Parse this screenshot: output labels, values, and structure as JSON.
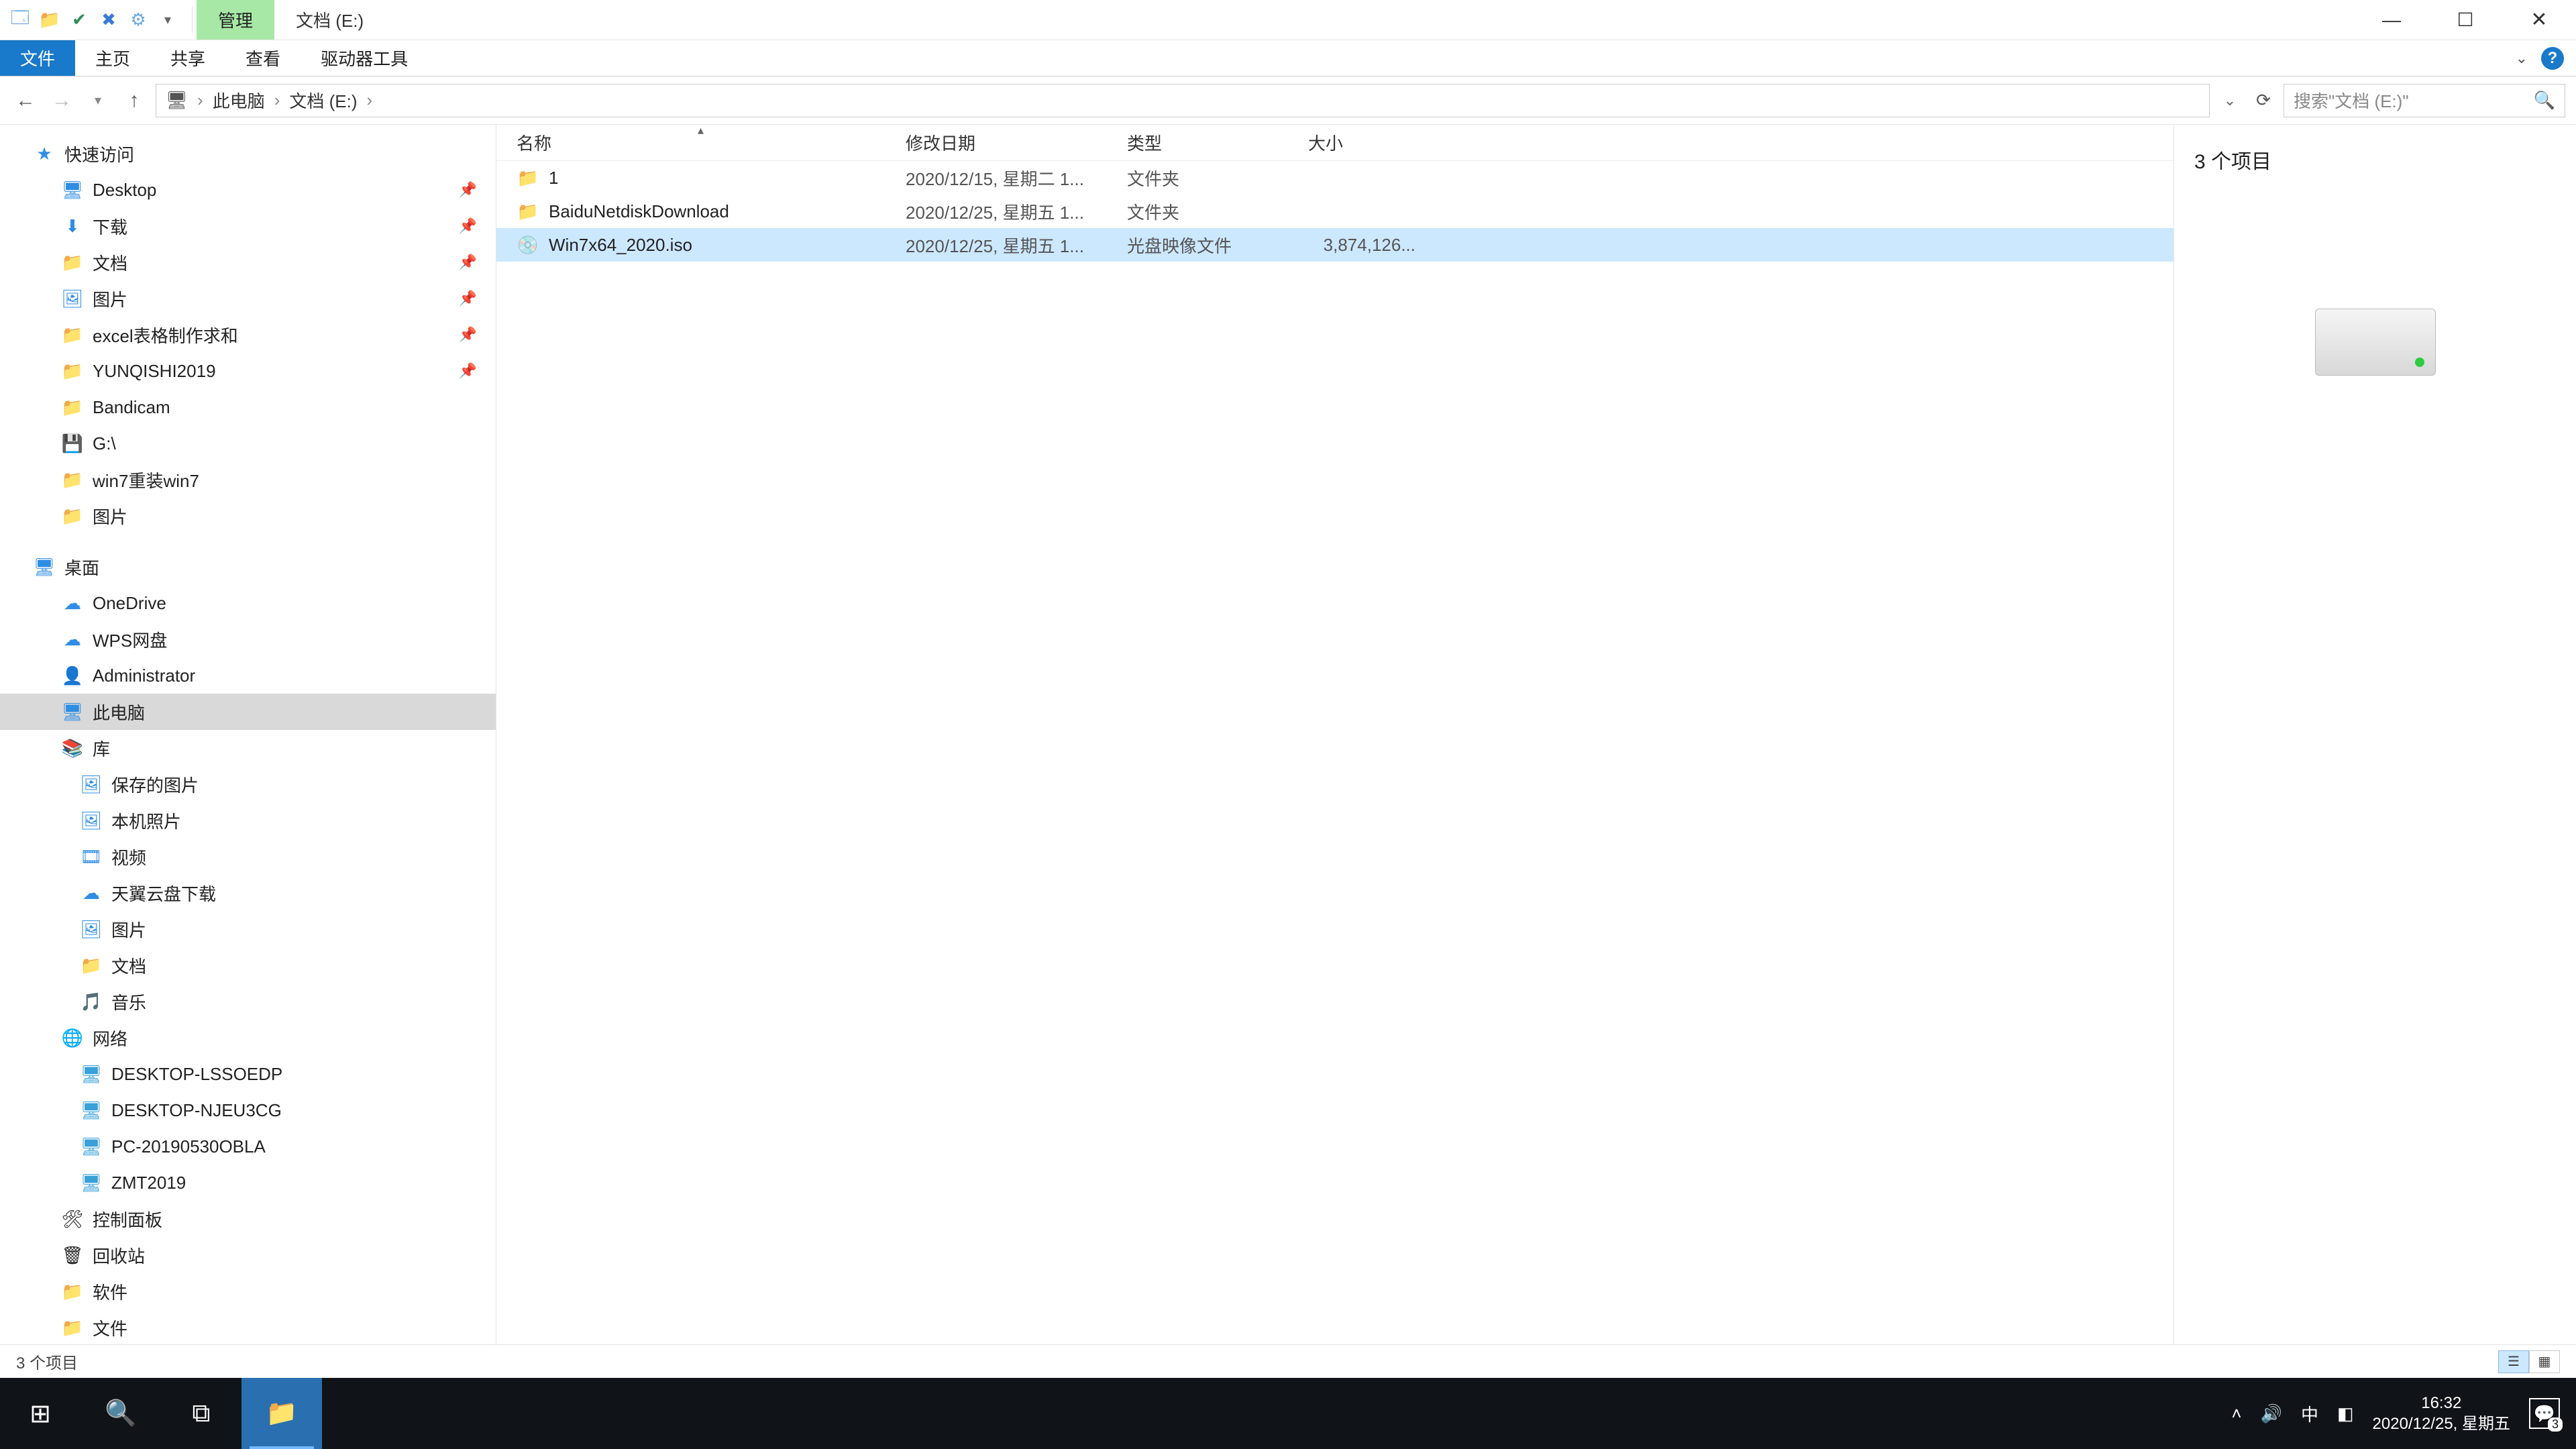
{
  "titlebar": {
    "contextual_tab": "管理",
    "window_title": "文档 (E:)"
  },
  "ribbon": {
    "file": "文件",
    "home": "主页",
    "share": "共享",
    "view": "查看",
    "drive_tools": "驱动器工具"
  },
  "address": {
    "root": "此电脑",
    "current": "文档 (E:)"
  },
  "search": {
    "placeholder": "搜索\"文档 (E:)\""
  },
  "tree": {
    "quick_access": "快速访问",
    "desktop": "Desktop",
    "downloads": "下载",
    "documents": "文档",
    "pictures": "图片",
    "excel_req": "excel表格制作求和",
    "yunqishi": "YUNQISHI2019",
    "bandicam": "Bandicam",
    "gdrive": "G:\\",
    "win7reinstall": "win7重装win7",
    "pictures2": "图片",
    "desktop_cn": "桌面",
    "onedrive": "OneDrive",
    "wps": "WPS网盘",
    "admin": "Administrator",
    "this_pc": "此电脑",
    "library": "库",
    "saved_pics": "保存的图片",
    "local_photos": "本机照片",
    "videos": "视频",
    "tianyi": "天翼云盘下载",
    "pictures3": "图片",
    "documents2": "文档",
    "music": "音乐",
    "network": "网络",
    "pc1": "DESKTOP-LSSOEDP",
    "pc2": "DESKTOP-NJEU3CG",
    "pc3": "PC-20190530OBLA",
    "pc4": "ZMT2019",
    "control_panel": "控制面板",
    "recycle": "回收站",
    "software": "软件",
    "files": "文件"
  },
  "columns": {
    "name": "名称",
    "date": "修改日期",
    "type": "类型",
    "size": "大小"
  },
  "rows": [
    {
      "name": "1",
      "date": "2020/12/15, 星期二 1...",
      "type": "文件夹",
      "size": "",
      "icon": "folder",
      "selected": false
    },
    {
      "name": "BaiduNetdiskDownload",
      "date": "2020/12/25, 星期五 1...",
      "type": "文件夹",
      "size": "",
      "icon": "folder",
      "selected": false
    },
    {
      "name": "Win7x64_2020.iso",
      "date": "2020/12/25, 星期五 1...",
      "type": "光盘映像文件",
      "size": "3,874,126...",
      "icon": "disc",
      "selected": true
    }
  ],
  "preview": {
    "title": "3 个项目"
  },
  "status": {
    "text": "3 个项目"
  },
  "taskbar": {
    "time": "16:32",
    "date": "2020/12/25, 星期五",
    "ime": "中",
    "notif_count": "3"
  }
}
